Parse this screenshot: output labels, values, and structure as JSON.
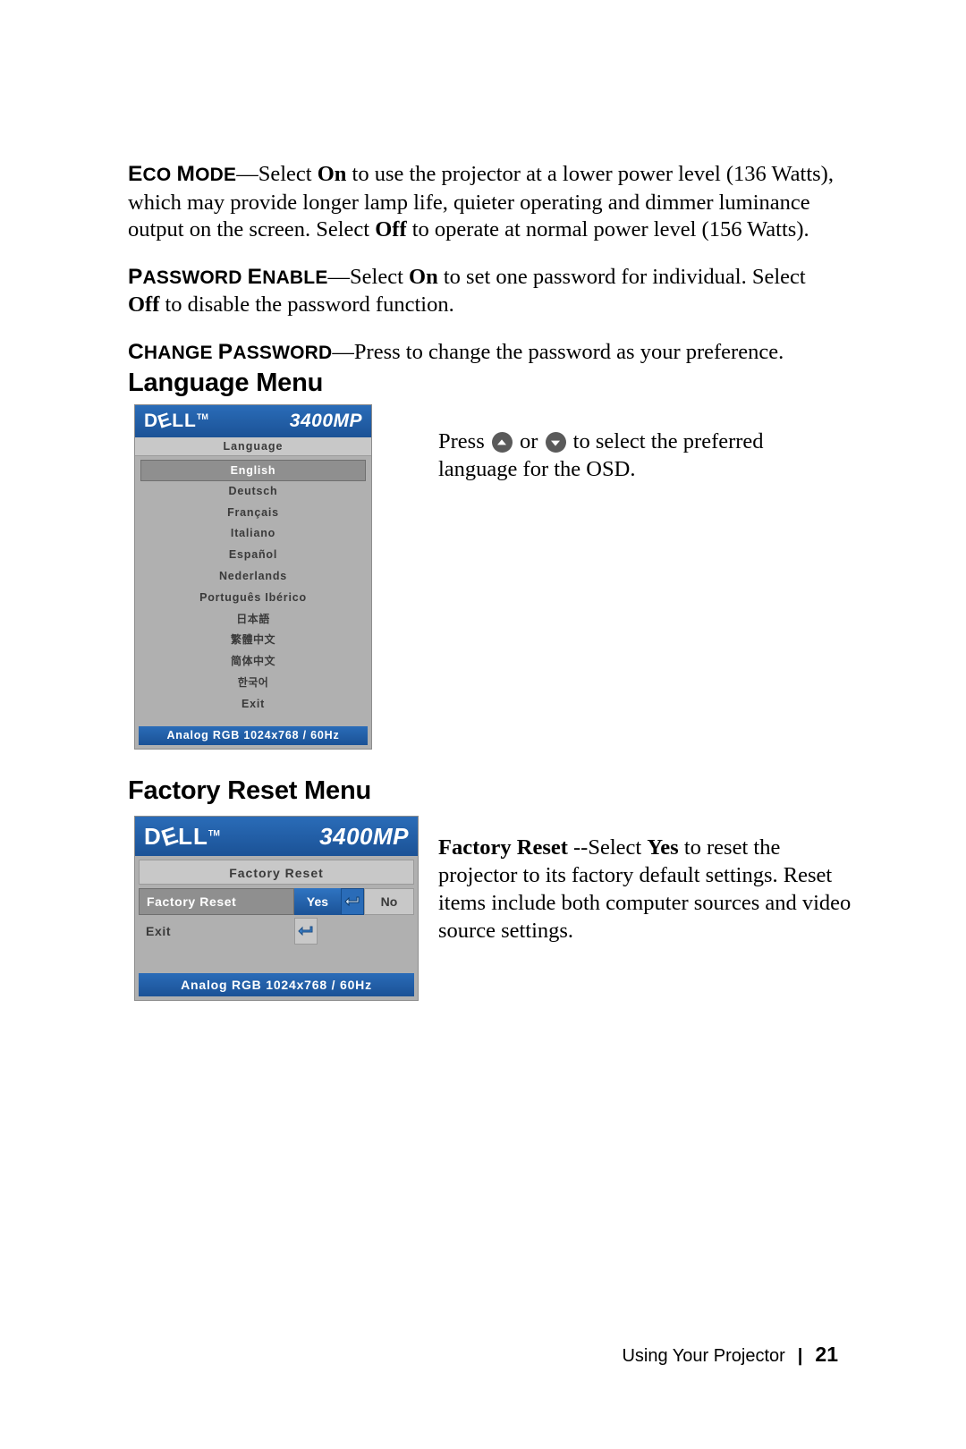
{
  "paragraphs": [
    {
      "term_caps": "E",
      "term_rest": "CO ",
      "term_caps2": "M",
      "term_rest2": "ODE",
      "text": "—Select On to use the projector at a lower power level (136 Watts), which may provide longer lamp life, quieter operating and dimmer luminance output on the screen. Select Off to operate at normal power level (156 Watts)."
    },
    {
      "text": "—Select On to set one password for individual. Select Off to disable the password function."
    },
    {
      "text": "—Press to change the password as your preference."
    }
  ],
  "eco_mode": {
    "term_html_1": "E",
    "term_html_2": "CO ",
    "term_html_3": "M",
    "term_html_4": "ODE",
    "body_1": "—Select ",
    "bold_on": "On",
    "body_2": " to use the projector at a lower power level (136 Watts), which may provide longer lamp life, quieter operating and dimmer luminance output on the screen. Select ",
    "bold_off": "Off",
    "body_3": " to operate at normal power level (156 Watts)."
  },
  "password_enable": {
    "term_1": "P",
    "term_2": "ASSWORD ",
    "term_3": "E",
    "term_4": "NABLE",
    "body_1": "—Select ",
    "bold_on": "On",
    "body_2": " to set one password for individual. Select ",
    "bold_off": "Off",
    "body_3": " to disable the password function."
  },
  "change_password": {
    "term_1": "C",
    "term_2": "HANGE ",
    "term_3": "P",
    "term_4": "ASSWORD",
    "body": "—Press to change the password as your preference."
  },
  "sections": {
    "language_heading": "Language Menu",
    "factory_heading": "Factory Reset Menu"
  },
  "language_osd": {
    "brand": "D",
    "brand_e": "E",
    "brand_rest": "LL",
    "tm": "TM",
    "model": "3400MP",
    "subtitle": "Language",
    "items": [
      {
        "label": "English",
        "selected": true,
        "cjk": false
      },
      {
        "label": "Deutsch",
        "selected": false,
        "cjk": false
      },
      {
        "label": "Français",
        "selected": false,
        "cjk": false
      },
      {
        "label": "Italiano",
        "selected": false,
        "cjk": false
      },
      {
        "label": "Español",
        "selected": false,
        "cjk": false
      },
      {
        "label": "Nederlands",
        "selected": false,
        "cjk": false
      },
      {
        "label": "Português Ibérico",
        "selected": false,
        "cjk": false
      },
      {
        "label": "日本語",
        "selected": false,
        "cjk": true
      },
      {
        "label": "繁體中文",
        "selected": false,
        "cjk": true
      },
      {
        "label": "简体中文",
        "selected": false,
        "cjk": true
      },
      {
        "label": "한국어",
        "selected": false,
        "cjk": true
      },
      {
        "label": "Exit",
        "selected": false,
        "cjk": false
      }
    ],
    "footer": "Analog RGB 1024x768 / 60Hz"
  },
  "language_side_text": {
    "prefix": "Press ",
    "middle": " or ",
    "suffix": " to select the preferred language for the OSD."
  },
  "factory_osd": {
    "brand": "D",
    "brand_e": "E",
    "brand_rest": "LL",
    "tm": "TM",
    "model": "3400MP",
    "subtitle": "Factory Reset",
    "rows": [
      {
        "label": "Factory Reset",
        "yes": "Yes",
        "no": "No"
      },
      {
        "label": "Exit"
      }
    ],
    "footer": "Analog RGB 1024x768 / 60Hz"
  },
  "factory_side_text": {
    "bold": "Factory Reset",
    "rest_1": " --Select ",
    "bold2": "Yes",
    "rest_2": " to reset the projector to its factory default settings. Reset items include both computer sources and video source settings."
  },
  "footer": {
    "label": "Using Your Projector",
    "separator": "|",
    "page_number": "21"
  },
  "colors": {
    "osd_blue": "#1f5fa9",
    "osd_gray": "#b0b0b0",
    "osd_selected": "#8f8f8f"
  }
}
